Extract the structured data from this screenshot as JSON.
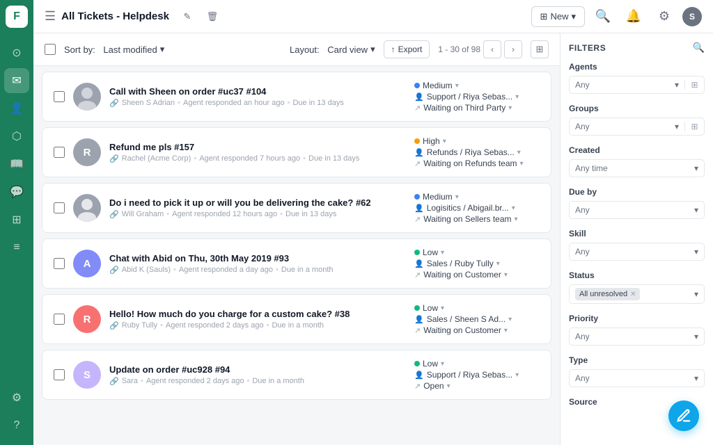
{
  "app": {
    "logo": "F",
    "title": "All Tickets - Helpdesk",
    "user_initial": "S"
  },
  "sidebar": {
    "icons": [
      {
        "name": "menu-icon",
        "symbol": "☰",
        "active": false
      },
      {
        "name": "home-icon",
        "symbol": "⊙",
        "active": false
      },
      {
        "name": "inbox-icon",
        "symbol": "✉",
        "active": true
      },
      {
        "name": "contacts-icon",
        "symbol": "👤",
        "active": false
      },
      {
        "name": "groups-icon",
        "symbol": "⬡",
        "active": false
      },
      {
        "name": "reports-icon",
        "symbol": "📖",
        "active": false
      },
      {
        "name": "chat-icon",
        "symbol": "💬",
        "active": false
      },
      {
        "name": "integration-icon",
        "symbol": "⊞",
        "active": false
      },
      {
        "name": "list-icon",
        "symbol": "☰",
        "active": false
      },
      {
        "name": "settings-icon",
        "symbol": "⚙",
        "active": false
      }
    ],
    "bottom_icons": [
      {
        "name": "help-icon",
        "symbol": "?",
        "active": false
      }
    ]
  },
  "toolbar": {
    "new_button": "New",
    "sort_label": "Sort by:",
    "sort_value": "Last modified",
    "layout_label": "Layout:",
    "layout_value": "Card view",
    "export_label": "Export",
    "pagination": "1 - 30 of 98"
  },
  "tickets": [
    {
      "id": "ticket-1",
      "avatar_text": "",
      "avatar_img": true,
      "avatar_color": "#9ca3af",
      "title": "Call with Sheen on order #uc37 #104",
      "agent": "Sheen S Adrian",
      "meta": "Agent responded an hour ago • Due in 13 days",
      "priority_label": "Medium",
      "priority_color": "blue",
      "team": "Support / Riya Sebas...",
      "status": "Waiting on Third Party"
    },
    {
      "id": "ticket-2",
      "avatar_text": "R",
      "avatar_img": false,
      "avatar_color": "#9ca3af",
      "title": "Refund me pls #157",
      "agent": "Rachel (Acme Corp)",
      "meta": "Agent responded 7 hours ago • Due in 13 days",
      "priority_label": "High",
      "priority_color": "yellow",
      "team": "Refunds / Riya Sebas...",
      "status": "Waiting on Refunds team"
    },
    {
      "id": "ticket-3",
      "avatar_text": "",
      "avatar_img": true,
      "avatar_color": "#9ca3af",
      "title": "Do i need to pick it up or will you be delivering the cake? #62",
      "agent": "Will Graham",
      "meta": "Agent responded 12 hours ago • Due in 13 days",
      "priority_label": "Medium",
      "priority_color": "blue",
      "team": "Logisitics / Abigail.br...",
      "status": "Waiting on Sellers team"
    },
    {
      "id": "ticket-4",
      "avatar_text": "A",
      "avatar_img": false,
      "avatar_color": "#818cf8",
      "title": "Chat with Abid on Thu, 30th May 2019 #93",
      "agent": "Abid K (Sauls)",
      "meta": "Agent responded a day ago • Due in a month",
      "priority_label": "Low",
      "priority_color": "green",
      "team": "Sales / Ruby Tully",
      "status": "Waiting on Customer"
    },
    {
      "id": "ticket-5",
      "avatar_text": "R",
      "avatar_img": false,
      "avatar_color": "#f87171",
      "title": "Hello! How much do you charge for a custom cake? #38",
      "agent": "Ruby Tully",
      "meta": "Agent responded 2 days ago • Due in a month",
      "priority_label": "Low",
      "priority_color": "green",
      "team": "Sales / Sheen S Ad...",
      "status": "Waiting on Customer"
    },
    {
      "id": "ticket-6",
      "avatar_text": "S",
      "avatar_img": false,
      "avatar_color": "#c4b5fd",
      "title": "Update on order #uc928 #94",
      "agent": "Sara",
      "meta": "Agent responded 2 days ago • Due in a month",
      "priority_label": "Low",
      "priority_color": "green",
      "team": "Support / Riya Sebas...",
      "status": "Open"
    }
  ],
  "filters": {
    "title": "FILTERS",
    "agents_label": "Agents",
    "agents_value": "Any",
    "groups_label": "Groups",
    "groups_value": "Any",
    "created_label": "Created",
    "created_value": "Any time",
    "due_by_label": "Due by",
    "due_by_value": "Any",
    "skill_label": "Skill",
    "skill_value": "Any",
    "status_label": "Status",
    "status_tag": "All unresolved",
    "priority_label": "Priority",
    "priority_value": "Any",
    "type_label": "Type",
    "type_value": "Any",
    "source_label": "Source"
  }
}
